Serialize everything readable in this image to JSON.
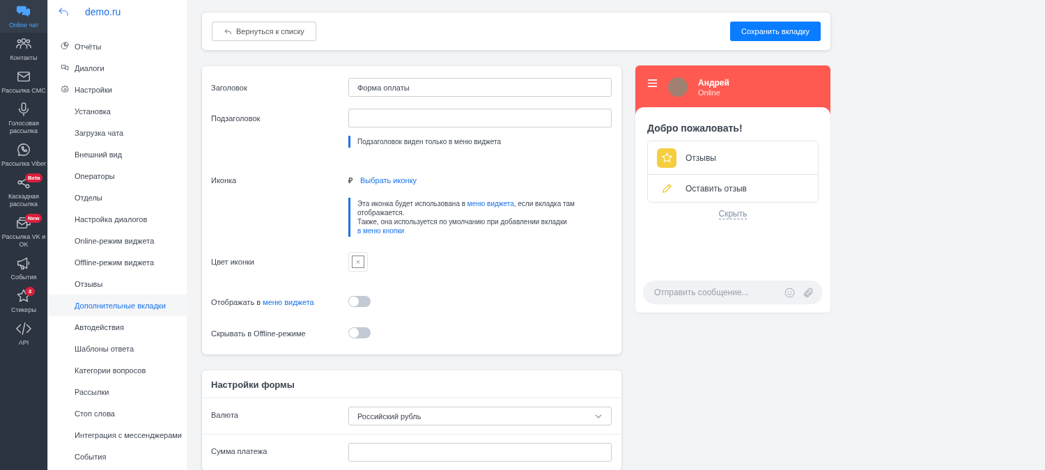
{
  "nav_rail": {
    "items": [
      {
        "kind": "chat",
        "label": "Online чат",
        "selected": true
      },
      {
        "kind": "contacts",
        "label": "Контакты",
        "selected": false
      },
      {
        "kind": "mail",
        "label": "Рассылка СМС",
        "selected": false
      },
      {
        "kind": "mic",
        "label": "Голосовая рассылка",
        "selected": false
      },
      {
        "kind": "viber",
        "label": "Рассылка Viber",
        "selected": false
      },
      {
        "kind": "share",
        "label": "Каскадная рассылка",
        "badge": "Beta",
        "selected": false
      },
      {
        "kind": "mails",
        "label": "Рассылка VK и OK",
        "badge": "New",
        "selected": false
      },
      {
        "kind": "megaphone",
        "label": "События",
        "selected": false
      },
      {
        "kind": "star",
        "label": "Стикеры",
        "badge": "3",
        "selected": false
      },
      {
        "kind": "code",
        "label": "API",
        "selected": false
      }
    ]
  },
  "sidebar": {
    "site": "demo.ru",
    "items": [
      {
        "kind": "reports",
        "label": "Отчёты",
        "selected": false
      },
      {
        "kind": "dialogs",
        "label": "Диалоги",
        "selected": false
      },
      {
        "kind": "settings",
        "label": "Настройки",
        "selected": false,
        "children": [
          {
            "label": "Установка",
            "selected": false
          },
          {
            "label": "Загрузка чата",
            "selected": false
          },
          {
            "label": "Внешний вид",
            "selected": false
          },
          {
            "label": "Операторы",
            "selected": false
          },
          {
            "label": "Отделы",
            "selected": false
          },
          {
            "label": "Настройка диалогов",
            "selected": false
          },
          {
            "label": "Online-режим виджета",
            "selected": false
          },
          {
            "label": "Offline-режим виджета",
            "selected": false
          },
          {
            "label": "Отзывы",
            "selected": false
          },
          {
            "label": "Дополнительные вкладки",
            "selected": true
          },
          {
            "label": "Автодействия",
            "selected": false
          },
          {
            "label": "Шаблоны ответа",
            "selected": false
          },
          {
            "label": "Категории вопросов",
            "selected": false
          },
          {
            "label": "Рассылки",
            "selected": false
          },
          {
            "label": "Стоп слова",
            "selected": false
          },
          {
            "label": "Интеграция с мессенджерами",
            "selected": false
          },
          {
            "label": "События",
            "selected": false
          }
        ]
      }
    ]
  },
  "toolbar": {
    "back_button": "Вернуться к списку",
    "save_button": "Сохранить вкладку"
  },
  "tab_form": {
    "rows": [
      {
        "kind": "text",
        "label": "Заголовок",
        "value": "Форма оплаты"
      },
      {
        "kind": "text",
        "label": "Подзаголовок",
        "value": "",
        "hint": [
          {
            "text": "Подзаголовок виден только в меню виджета",
            "link": false
          }
        ]
      },
      {
        "kind": "icon",
        "label": "Иконка",
        "icon_glyph": "₽",
        "action": "Выбрать иконку",
        "hint": [
          {
            "text": "Эта иконка будет использована в ",
            "link": false
          },
          {
            "text": "меню виджета",
            "link": true
          },
          {
            "text": ", если вкладка там отображается.\nТакже, она используется по умолчанию при добавлении вкладки ",
            "link": false
          },
          {
            "text": "в меню кнопки",
            "link": true
          }
        ]
      },
      {
        "kind": "color",
        "label": "Цвет иконки",
        "glyph": "×"
      },
      {
        "kind": "toggle",
        "label": "Отображать в",
        "label_link": "меню виджета",
        "on": false
      },
      {
        "kind": "toggle",
        "label": "Скрывать в Offline-режиме",
        "on": false
      }
    ]
  },
  "form_settings": {
    "title": "Настройки формы",
    "rows": [
      {
        "kind": "select",
        "label": "Валюта",
        "value": "Российский рубль"
      },
      {
        "kind": "text",
        "label": "Сумма платежа",
        "value": ""
      }
    ]
  },
  "widget_preview": {
    "name": "Андрей",
    "status": "Online",
    "welcome": "Добро пожаловать!",
    "items": [
      {
        "kind": "star",
        "label": "Отзывы"
      },
      {
        "kind": "pencil",
        "label": "Оставить отзыв"
      }
    ],
    "hide_link": "Скрыть",
    "message_placeholder": "Отправить сообщение..."
  }
}
